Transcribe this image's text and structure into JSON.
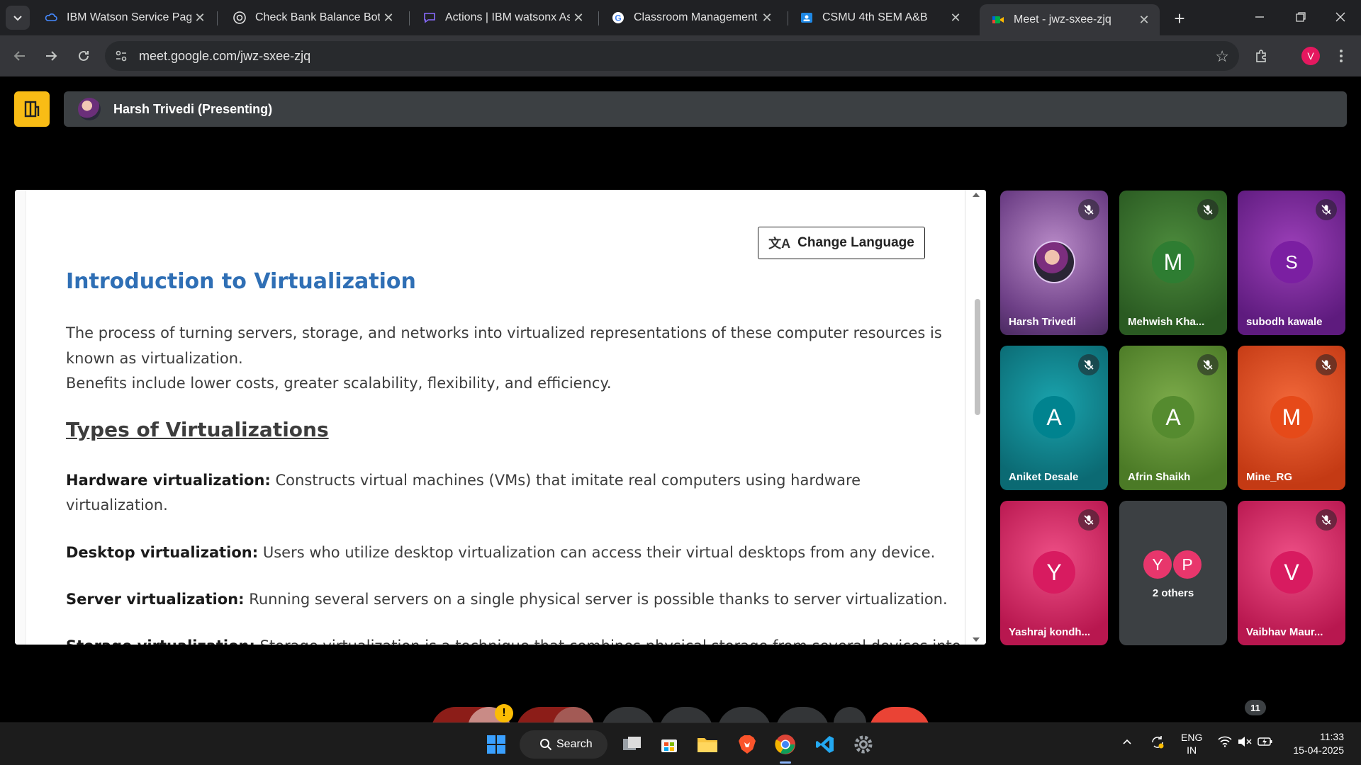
{
  "browser": {
    "tabs": [
      {
        "label": "IBM Watson Service Page",
        "icon": "cloud-icon",
        "active": false
      },
      {
        "label": "Check Bank Balance Bot",
        "icon": "openai-icon",
        "active": false
      },
      {
        "label": "Actions | IBM watsonx Assi",
        "icon": "chat-bubble-icon",
        "active": false
      },
      {
        "label": "Classroom Management To",
        "icon": "google-icon",
        "active": false
      },
      {
        "label": "CSMU 4th SEM A&B",
        "icon": "classroom-icon",
        "active": false
      },
      {
        "label": "Meet - jwz-sxee-zjq",
        "icon": "meet-icon",
        "active": true
      }
    ],
    "url": "meet.google.com/jwz-sxee-zjq",
    "profile_initial": "V"
  },
  "meet": {
    "presenting_label": "Harsh Trivedi (Presenting)",
    "shared_content": {
      "button_label": "Change Language",
      "title": "Introduction to Virtualization",
      "intro_line1": "The process of turning servers, storage, and networks into virtualized representations of these computer resources is",
      "intro_line2": "known as virtualization.",
      "intro_line3": "Benefits include lower costs, greater scalability, flexibility, and efficiency.",
      "types_heading": "Types of Virtualizations",
      "items": [
        {
          "term": "Hardware virtualization:",
          "desc1": " Constructs virtual machines (VMs) that imitate real computers using hardware",
          "desc2": "virtualization."
        },
        {
          "term": "Desktop virtualization:",
          "desc1": " Users who utilize desktop virtualization can access their virtual desktops from any device.",
          "desc2": ""
        },
        {
          "term": "Server virtualization:",
          "desc1": " Running several servers on a single physical server is possible thanks to server virtualization.",
          "desc2": ""
        },
        {
          "term": "Storage virtualization:",
          "desc1": " Storage virtualization is a technique that combines physical storage from several devices into",
          "desc2": ""
        }
      ]
    },
    "participants": [
      {
        "name": "Harsh Trivedi",
        "initial": "",
        "muted": true,
        "bg": "#8a5aa0"
      },
      {
        "name": "Mehwish Kha...",
        "initial": "M",
        "muted": true,
        "bg": "#2e7d32"
      },
      {
        "name": "subodh kawale",
        "initial": "S",
        "muted": true,
        "bg": "#7b1fa2"
      },
      {
        "name": "Aniket Desale",
        "initial": "A",
        "muted": true,
        "bg": "#00838f"
      },
      {
        "name": "Afrin Shaikh",
        "initial": "A",
        "muted": true,
        "bg": "#558b2f"
      },
      {
        "name": "Mine_RG",
        "initial": "M",
        "muted": true,
        "bg": "#e64a19"
      },
      {
        "name": "Yashraj kondh...",
        "initial": "Y",
        "muted": true,
        "bg": "#d81b60"
      },
      {
        "name": "2 others",
        "initial": "",
        "muted": false,
        "bg": "#3c4043",
        "others": [
          "Y",
          "P"
        ]
      },
      {
        "name": "Vaibhav Maur...",
        "initial": "V",
        "muted": true,
        "bg": "#d81b60"
      }
    ],
    "participant_count": "11",
    "warning_badge": "!"
  },
  "taskbar": {
    "search_label": "Search",
    "language_line1": "ENG",
    "language_line2": "IN",
    "time": "11:33",
    "date": "15-04-2025"
  },
  "colors": {
    "meet_accent": "#f9bc15",
    "title_blue": "#2f6fb5",
    "leave_red": "#ea4335"
  }
}
